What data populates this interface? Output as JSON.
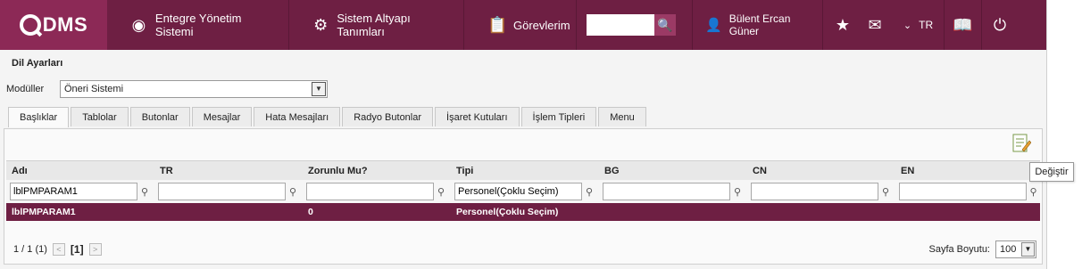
{
  "header": {
    "logo": "DMS",
    "nav": [
      {
        "label": "Entegre Yönetim Sistemi",
        "icon": "target-icon"
      },
      {
        "label": "Sistem Altyapı Tanımları",
        "icon": "gear-icon"
      },
      {
        "label": "Görevlerim",
        "icon": "clipboard-icon"
      }
    ],
    "search": {
      "value": "",
      "placeholder": ""
    },
    "user": "Bülent Ercan Güner",
    "lang": "TR"
  },
  "page": {
    "title": "Dil Ayarları",
    "module_label": "Modüller",
    "module_value": "Öneri Sistemi"
  },
  "tabs": [
    "Başlıklar",
    "Tablolar",
    "Butonlar",
    "Mesajlar",
    "Hata Mesajları",
    "Radyo Butonlar",
    "İşaret Kutuları",
    "İşlem Tipleri",
    "Menu"
  ],
  "grid": {
    "columns": [
      "Adı",
      "TR",
      "Zorunlu Mu?",
      "Tipi",
      "BG",
      "CN",
      "EN"
    ],
    "filters": [
      "lblPMPARAM1",
      "",
      "",
      "Personel(Çoklu Seçim)",
      "",
      "",
      ""
    ],
    "rows": [
      [
        "lblPMPARAM1",
        "",
        "0",
        "Personel(Çoklu Seçim)",
        "",
        "",
        ""
      ]
    ]
  },
  "pager": {
    "summary": "1 / 1 (1)",
    "current": "[1]",
    "page_size_label": "Sayfa Boyutu:",
    "page_size": "100"
  },
  "tooltip": "Değiştir",
  "colors": {
    "brand": "#6e1f43",
    "brand_light": "#8c2956"
  }
}
